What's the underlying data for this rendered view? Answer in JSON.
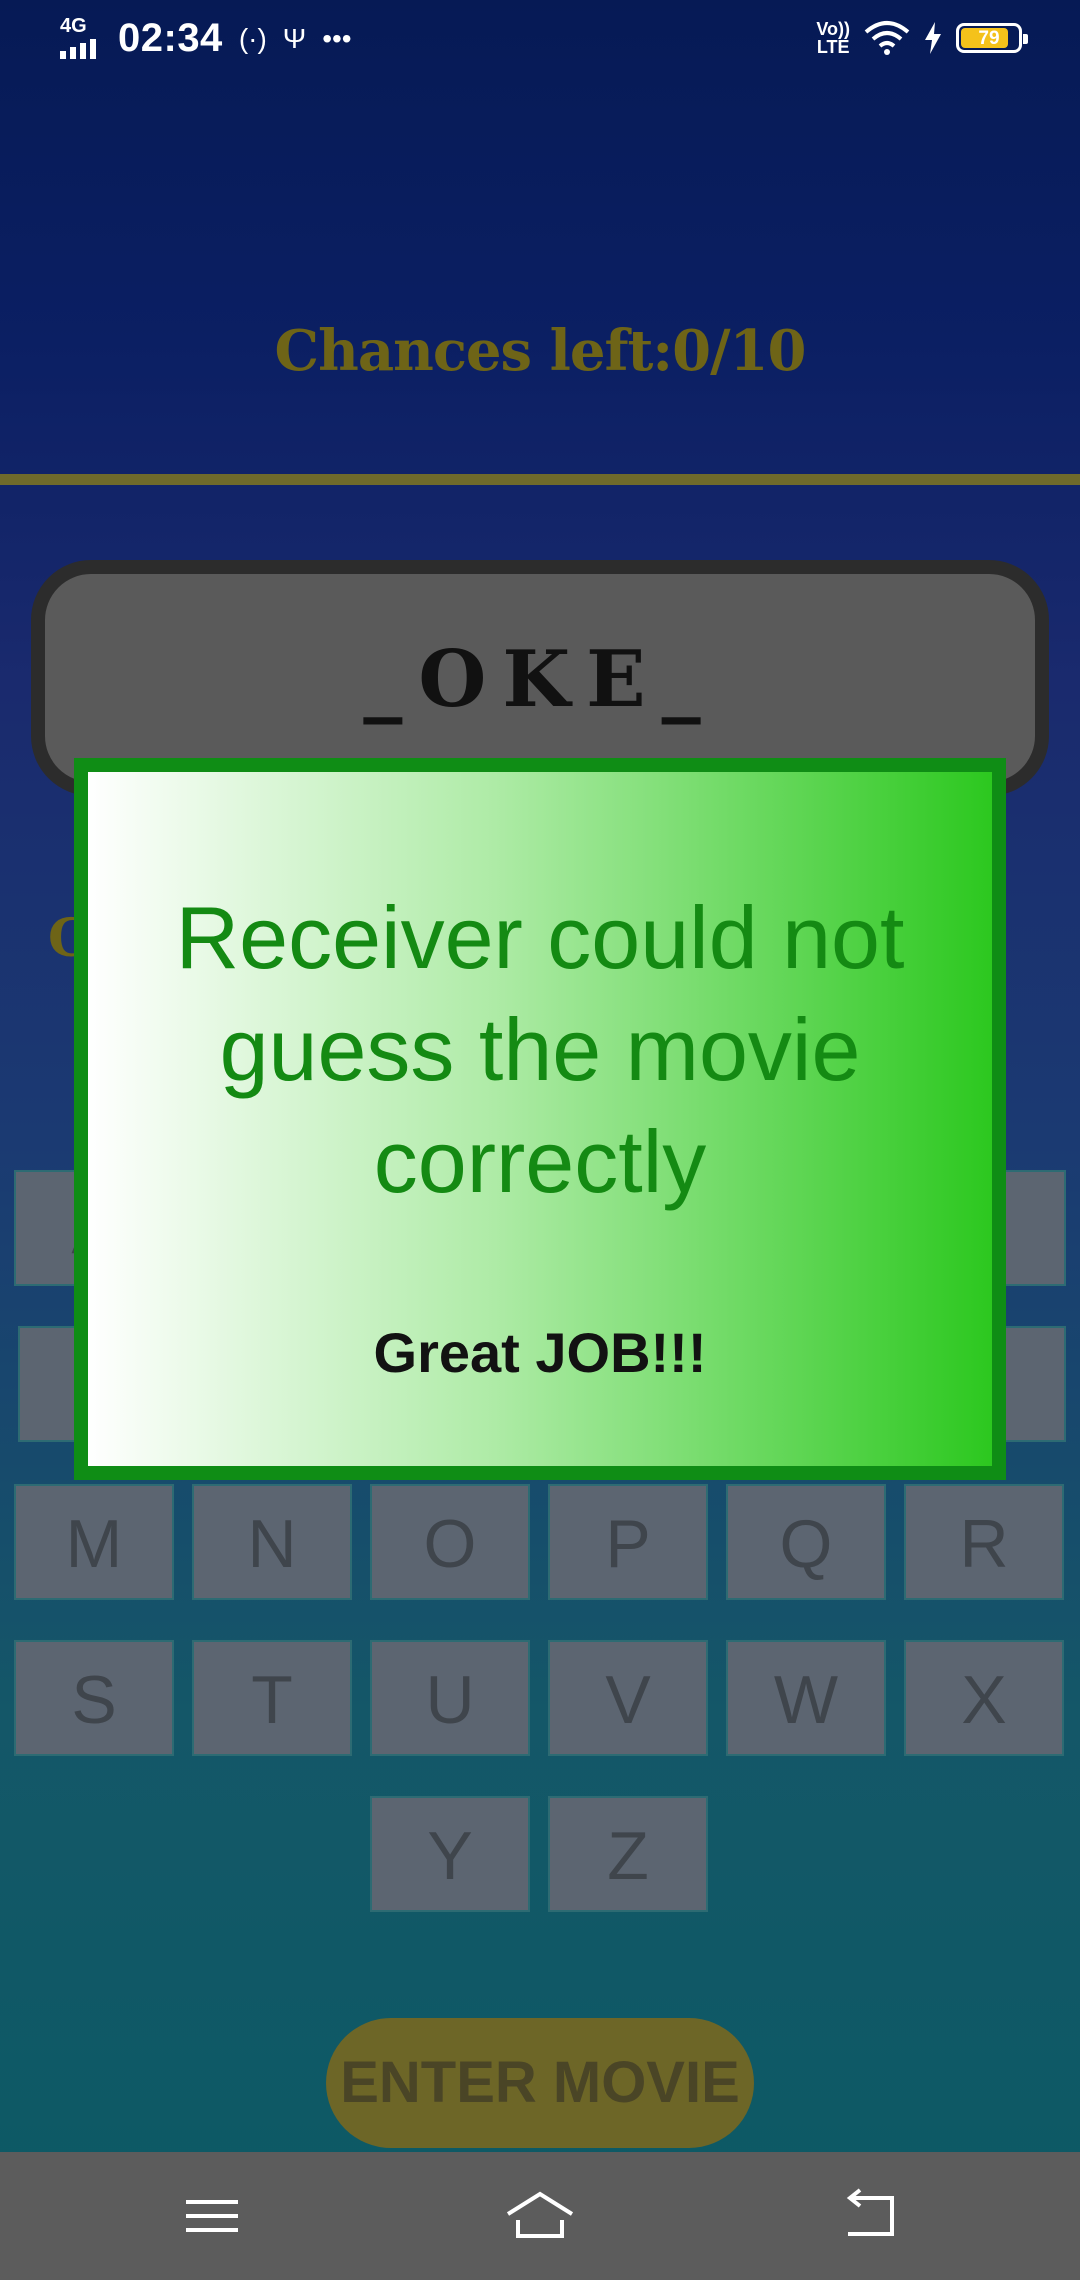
{
  "status_bar": {
    "network": "4G",
    "time": "02:34",
    "icons": [
      "hotspot-icon",
      "usb-icon",
      "more-dots-icon"
    ],
    "volte": [
      "Vo))",
      "LTE"
    ],
    "battery_level": "79"
  },
  "game": {
    "chances_label": "Chances left:0/10",
    "word": "_OKE_",
    "partial_label_char": "G",
    "keys_partial": [
      "A"
    ],
    "keys_row3": [
      "M",
      "N",
      "O",
      "P",
      "Q",
      "R"
    ],
    "keys_row4": [
      "S",
      "T",
      "U",
      "V",
      "W",
      "X"
    ],
    "keys_row5": [
      "Y",
      "Z"
    ],
    "enter_button": "ENTER MOVIE"
  },
  "dialog": {
    "message": "Receiver could not guess the movie correctly",
    "sub": "Great JOB!!!"
  },
  "colors": {
    "accent_gold": "#6e6417",
    "dialog_green": "#148a13",
    "dialog_border": "#0f8d15"
  },
  "navbar": {
    "icons": [
      "menu-icon",
      "home-icon",
      "back-icon"
    ]
  }
}
